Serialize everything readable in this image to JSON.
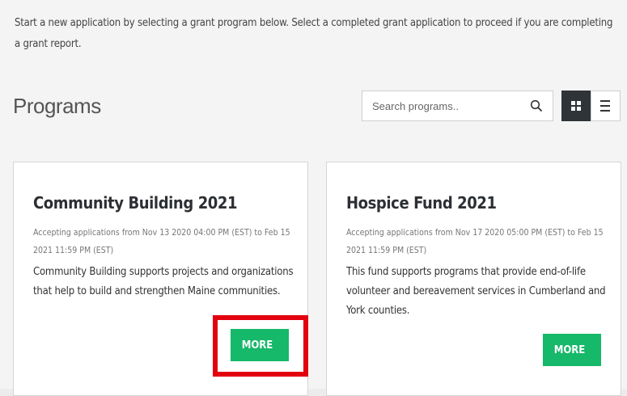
{
  "intro": {
    "text": "Start a new application by selecting a grant program below. Select a completed grant application to proceed if you are completing a grant report."
  },
  "header": {
    "title": "Programs",
    "search": {
      "placeholder": "Search programs..",
      "value": "",
      "icon": "search-icon"
    },
    "view_toggle": {
      "grid_icon": "grid-view-icon",
      "list_icon": "list-view-icon",
      "active": "grid"
    }
  },
  "programs": [
    {
      "title": "Community Building 2021",
      "dates": "Accepting applications from Nov 13 2020 04:00 PM (EST) to Feb 15 2021 11:59 PM (EST)",
      "description": "Community Building supports projects and organizations that help to build and strengthen Maine communities.",
      "button_label": "MORE",
      "highlighted": true
    },
    {
      "title": "Hospice Fund 2021",
      "dates": "Accepting applications from Nov 17 2020 05:00 PM (EST) to Feb 15 2021 11:59 PM (EST)",
      "description": "This fund supports programs that provide end-of-life volunteer and bereavement services in Cumberland and York counties.",
      "button_label": "MORE",
      "highlighted": false
    }
  ],
  "colors": {
    "accent": "#16b86a",
    "highlight": "#e3000f",
    "active_toggle": "#2f3438"
  }
}
